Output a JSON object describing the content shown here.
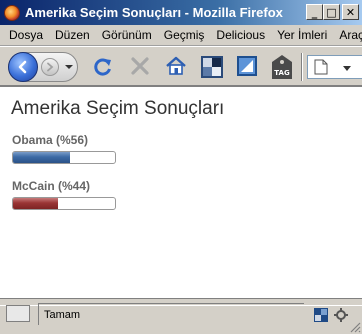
{
  "window": {
    "title": "Amerika Seçim Sonuçları - Mozilla Firefox",
    "controls": {
      "minimize": "_",
      "maximize": "□",
      "close": "✕"
    }
  },
  "menu": [
    "Dosya",
    "Düzen",
    "Görünüm",
    "Geçmiş",
    "Delicious",
    "Yer İmleri",
    "Araçla"
  ],
  "toolbar": {
    "icons": [
      "back-icon",
      "forward-icon",
      "history-dropdown-icon",
      "reload-icon",
      "stop-icon",
      "home-icon",
      "bookmark-icon",
      "page-info-icon",
      "tag-icon",
      "page-icon"
    ],
    "tag_label": "TAG"
  },
  "page": {
    "title": "Amerika Seçim Sonuçları",
    "candidates": [
      {
        "label": "Obama (%56)",
        "fraction": 0.56,
        "color": "#3c6aa5"
      },
      {
        "label": "McCain (%44)",
        "fraction": 0.44,
        "color": "#9a3535"
      }
    ]
  },
  "status": {
    "text": "Tamam"
  }
}
